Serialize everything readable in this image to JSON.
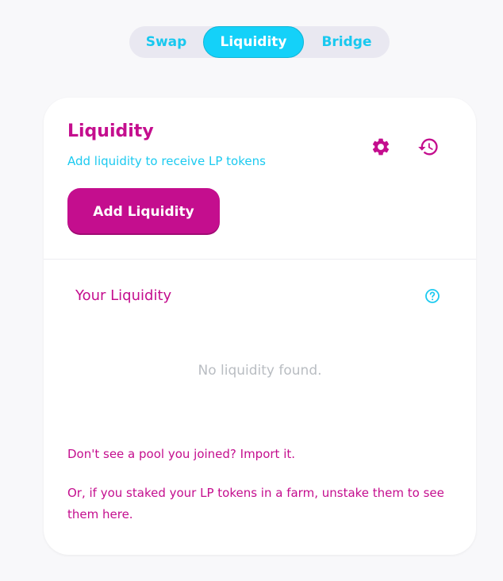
{
  "nav": {
    "tabs": [
      {
        "label": "Swap"
      },
      {
        "label": "Liquidity",
        "active": true
      },
      {
        "label": "Bridge"
      }
    ]
  },
  "card": {
    "title": "Liquidity",
    "subtitle": "Add liquidity to receive LP tokens",
    "settings_icon": "gear-icon",
    "history_icon": "history-icon",
    "add_button_label": "Add Liquidity",
    "your_liquidity_label": "Your Liquidity",
    "help_icon": "question-circle-icon",
    "empty_message": "No liquidity found.",
    "import_text": "Don't see a pool you joined? Import it.",
    "unstake_text": "Or, if you staked your LP tokens in a farm, unstake them to see them here."
  },
  "colors": {
    "primary": "#c40e8e",
    "accent": "#1ccaf0",
    "muted": "#b9bdc2",
    "background": "#f8f8fa"
  }
}
